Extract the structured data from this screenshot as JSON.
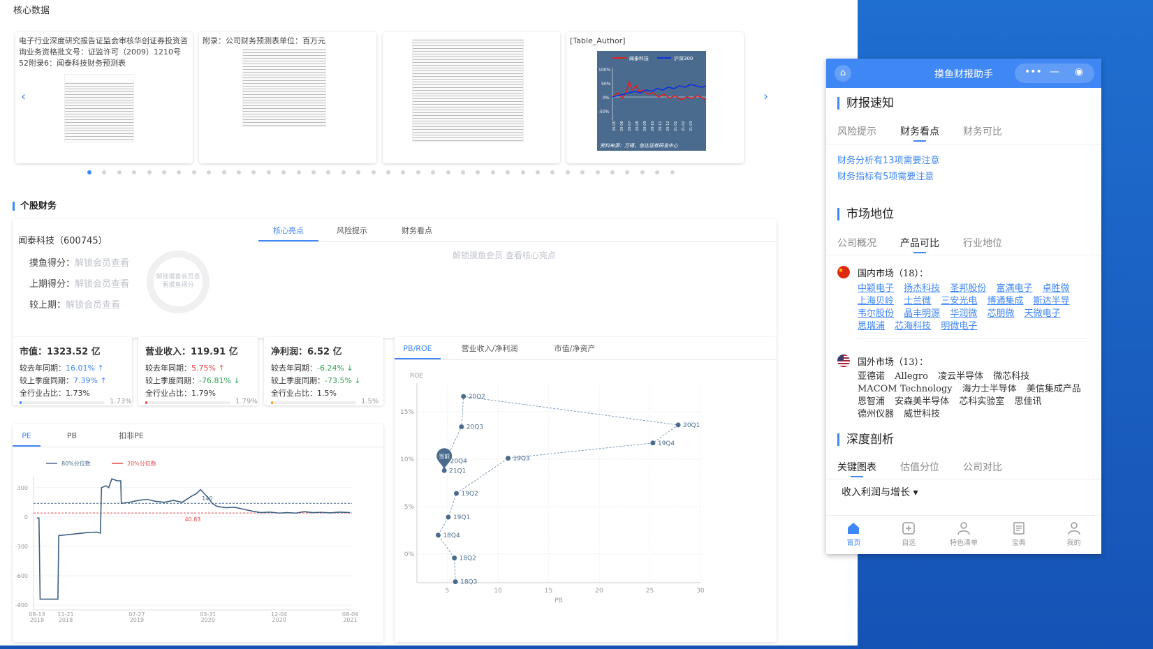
{
  "core": {
    "title": "核心数据",
    "cards": [
      {
        "caption": "电子行业深度研究报告证监会审核华创证券投资咨询业务资格批文号：证监许可（2009）1210号52附录6：闻泰科技财务预测表"
      },
      {
        "caption": "附录：公司财务预测表单位：百万元"
      },
      {
        "caption": ""
      },
      {
        "caption": "[Table_Author]",
        "chart_legend_a": "闻泰科技",
        "chart_legend_b": "沪深300",
        "chart_source": "资料来源：万得，信达证券研发中心",
        "y_ticks": [
          "100%",
          "50%",
          "0%",
          "-50%"
        ],
        "x_ticks": [
          "20-05",
          "20-06",
          "20-07",
          "20-08",
          "20-09",
          "20-10",
          "20-11",
          "20-12",
          "21-01",
          "21-02",
          "21-03"
        ]
      }
    ],
    "prev_arrow": "‹",
    "next_arrow": "›"
  },
  "stock": {
    "section_title": "个股财务",
    "company": "闻泰科技（600745）",
    "scores": [
      {
        "label": "摸鱼得分：",
        "value": "解锁会员查看"
      },
      {
        "label": "上期得分：",
        "value": "解锁会员查看"
      },
      {
        "label": "较上期：",
        "value": "解锁会员查看"
      }
    ],
    "ring_text": "解锁摸鱼会员查看摸鱼得分",
    "tabs": [
      "核心亮点",
      "风险提示",
      "财务看点"
    ],
    "unlock_tip": "解锁摸鱼会员 查看核心亮点"
  },
  "metrics": [
    {
      "title": "市值：1323.52 亿",
      "yoy_label": "较去年同期：",
      "yoy": "16.01% ↑",
      "qoq_label": "较上季度同期：",
      "qoq": "7.39% ↑",
      "share_label": "全行业占比：",
      "share": "1.73%",
      "share_pct": 1.73,
      "bar_color": "#3f87f5"
    },
    {
      "title": "营业收入：119.91 亿",
      "yoy_label": "较去年同期：",
      "yoy": "5.75% ↑",
      "qoq_label": "较上季度同期：",
      "qoq": "-76.81% ↓",
      "share_label": "全行业占比：",
      "share": "1.79%",
      "share_pct": 1.79,
      "bar_color": "#e04b4b"
    },
    {
      "title": "净利润：6.52 亿",
      "yoy_label": "较去年同期：",
      "yoy": "-6.24% ↓",
      "qoq_label": "较上季度同期：",
      "qoq": "-73.5% ↓",
      "share_label": "全行业占比：",
      "share": "1.5%",
      "share_pct": 1.5,
      "bar_color": "#f0a020"
    }
  ],
  "pe_panel": {
    "tabs": [
      "PE",
      "PB",
      "扣非PE"
    ],
    "legend_80": "80%分位数",
    "legend_20": "20%分位数"
  },
  "pb_panel": {
    "tabs": [
      "PB/ROE",
      "营业收入/净利润",
      "市值/净资产"
    ]
  },
  "chart_data": [
    {
      "type": "line",
      "title": "",
      "legend": [
        "80%分位数",
        "20%分位数"
      ],
      "y_ticks": [
        300,
        0,
        -300,
        -600,
        -900
      ],
      "ylim": [
        -950,
        420
      ],
      "x_ticks": [
        "08-13\n2018",
        "11-21\n2018",
        "07-27\n2019",
        "03-31\n2020",
        "12-04\n2020",
        "08-09\n2021"
      ],
      "x_tick_dates": [
        "2018-08-13",
        "2018-11-21",
        "2019-07-27",
        "2020-03-31",
        "2020-12-04",
        "2021-08-09"
      ],
      "xlim": [
        "2018-08-01",
        "2021-08-15"
      ],
      "percentile_80": 140,
      "percentile_20": 40.83,
      "percentile_80_label": "140",
      "percentile_20_label": "40.83",
      "series": [
        {
          "points": [
            [
              "2018-08-13",
              -10
            ],
            [
              "2018-08-20",
              -10
            ],
            [
              "2018-08-24",
              -840
            ],
            [
              "2018-09-20",
              -840
            ],
            [
              "2018-10-15",
              -840
            ],
            [
              "2018-10-25",
              -840
            ],
            [
              "2018-10-28",
              -190
            ],
            [
              "2018-12-01",
              -180
            ],
            [
              "2019-01-01",
              -170
            ],
            [
              "2019-02-01",
              -160
            ],
            [
              "2019-03-10",
              -155
            ],
            [
              "2019-03-22",
              -165
            ],
            [
              "2019-03-26",
              300
            ],
            [
              "2019-04-10",
              320
            ],
            [
              "2019-04-20",
              300
            ],
            [
              "2019-05-01",
              390
            ],
            [
              "2019-05-20",
              370
            ],
            [
              "2019-06-01",
              370
            ],
            [
              "2019-06-03",
              140
            ],
            [
              "2019-07-01",
              150
            ],
            [
              "2019-08-01",
              170
            ],
            [
              "2019-09-01",
              180
            ],
            [
              "2019-10-01",
              160
            ],
            [
              "2019-11-01",
              150
            ],
            [
              "2019-12-01",
              170
            ],
            [
              "2020-01-01",
              150
            ],
            [
              "2020-02-01",
              210
            ],
            [
              "2020-02-20",
              240
            ],
            [
              "2020-03-05",
              280
            ],
            [
              "2020-03-31",
              200
            ],
            [
              "2020-04-15",
              140
            ],
            [
              "2020-05-01",
              110
            ],
            [
              "2020-06-01",
              95
            ],
            [
              "2020-07-01",
              100
            ],
            [
              "2020-08-01",
              80
            ],
            [
              "2020-09-01",
              60
            ],
            [
              "2020-10-01",
              45
            ],
            [
              "2020-11-01",
              50
            ],
            [
              "2020-12-04",
              40
            ],
            [
              "2021-01-01",
              45
            ],
            [
              "2021-02-01",
              40
            ],
            [
              "2021-03-01",
              55
            ],
            [
              "2021-04-01",
              45
            ],
            [
              "2021-05-01",
              48
            ],
            [
              "2021-06-01",
              42
            ],
            [
              "2021-07-01",
              50
            ],
            [
              "2021-08-09",
              45
            ]
          ]
        }
      ]
    },
    {
      "type": "scatter",
      "title": "",
      "xlabel": "PB",
      "ylabel": "ROE",
      "x_ticks": [
        5,
        10,
        15,
        20,
        25,
        30
      ],
      "y_ticks": [
        "0%",
        "5%",
        "10%",
        "15%"
      ],
      "xlim": [
        2,
        30
      ],
      "ylim": [
        -3,
        18
      ],
      "current_label": "当前",
      "points": [
        {
          "label": "18Q3",
          "x": 5.8,
          "y": -2.9
        },
        {
          "label": "18Q2",
          "x": 5.7,
          "y": -0.4
        },
        {
          "label": "18Q4",
          "x": 4.1,
          "y": 2.0
        },
        {
          "label": "19Q1",
          "x": 5.1,
          "y": 3.9
        },
        {
          "label": "19Q2",
          "x": 5.9,
          "y": 6.4
        },
        {
          "label": "19Q3",
          "x": 11.0,
          "y": 10.1
        },
        {
          "label": "19Q4",
          "x": 25.3,
          "y": 11.7
        },
        {
          "label": "20Q1",
          "x": 27.8,
          "y": 13.6
        },
        {
          "label": "20Q2",
          "x": 6.6,
          "y": 16.6
        },
        {
          "label": "20Q3",
          "x": 6.4,
          "y": 13.4
        },
        {
          "label": "20Q4",
          "x": 4.8,
          "y": 9.8
        },
        {
          "label": "21Q1",
          "x": 4.7,
          "y": 8.8
        }
      ]
    }
  ],
  "widget": {
    "title": "摸鱼财报助手",
    "home_icon": "⌂",
    "ctrl_more": "•••",
    "ctrl_min": "—",
    "ctrl_close": "◉",
    "s1_title": "财报速知",
    "s1_tabs": [
      "风险提示",
      "财务看点",
      "财务可比"
    ],
    "s1_links": [
      "财务分析有13项需要注意",
      "财务指标有5项需要注意"
    ],
    "s2_title": "市场地位",
    "s2_tabs": [
      "公司概况",
      "产品可比",
      "行业地位"
    ],
    "domestic_title": "国内市场（18）：",
    "domestic": [
      "中颖电子",
      "扬杰科技",
      "圣邦股份",
      "富满电子",
      "卓胜微",
      "上海贝岭",
      "士兰微",
      "三安光电",
      "博通集成",
      "斯达半导",
      "韦尔股份",
      "晶丰明源",
      "华润微",
      "芯朋微",
      "天微电子",
      "思瑞浦",
      "芯海科技",
      "明微电子"
    ],
    "foreign_title": "国外市场（13）：",
    "foreign": [
      "亚德诺",
      "Allegro",
      "凌云半导体",
      "微芯科技",
      "MACOM Technology",
      "海力士半导体",
      "美信集成产品",
      "恩智浦",
      "安森美半导体",
      "芯科实验室",
      "思佳讯",
      "德州仪器",
      "威世科技"
    ],
    "s3_title": "深度剖析",
    "s3_tabs": [
      "关键图表",
      "估值分位",
      "公司对比"
    ],
    "dropdown": "收入利润与增长 ▾",
    "nav": [
      "首页",
      "自选",
      "特色清单",
      "宝典",
      "我的"
    ],
    "accent": "#3f87f5"
  }
}
